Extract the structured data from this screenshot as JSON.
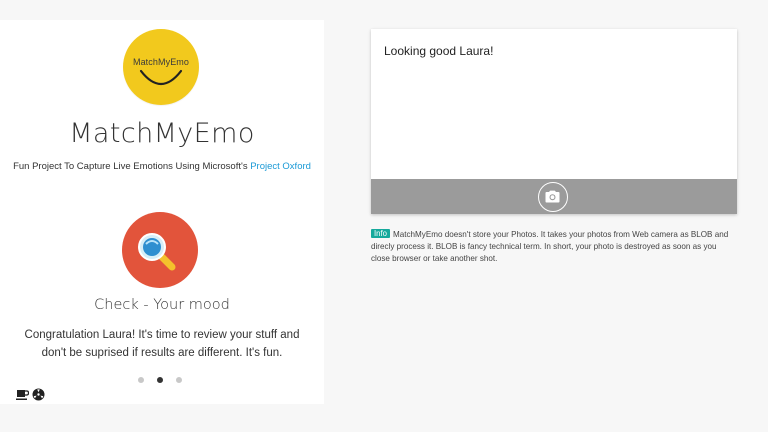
{
  "left_panel": {
    "logo_text": "MatchMyEmo",
    "app_title": "MatchMyEmo",
    "subtitle_prefix": "Fun Project To Capture Live Emotions Using Microsoft's ",
    "subtitle_link": "Project Oxford",
    "slide_title": "Check - Your mood",
    "slide_text": "Congratulation Laura! It's time to review your stuff and don't be suprised if results are different. It's fun.",
    "carousel_dots": [
      {
        "active": false
      },
      {
        "active": true
      },
      {
        "active": false
      }
    ],
    "icons": {
      "logo": "smile-icon",
      "mood": "magnifier-icon",
      "footer_left": "coffee-icon",
      "footer_right": "radiation-icon"
    }
  },
  "camera_card": {
    "greeting": "Looking good Laura!",
    "camera_icon": "camera-icon"
  },
  "info": {
    "badge": "Info",
    "text": "MatchMyEmo doesn't store your Photos. It takes your photos from Web camera as BLOB and direcly process it. BLOB is fancy technical term. In short, your photo is destroyed as soon as you close browser or take another shot."
  },
  "colors": {
    "logo": "#f2c91d",
    "mood_circle": "#e2543b",
    "link": "#1b9ad6",
    "camera_bar": "#9b9b9b",
    "info_badge": "#16a99c"
  }
}
